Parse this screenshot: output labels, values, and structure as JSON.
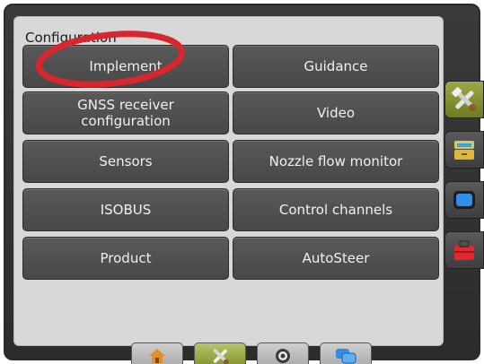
{
  "panel": {
    "title": "Configuration"
  },
  "grid": {
    "implement": "Implement",
    "guidance": "Guidance",
    "gnss": "GNSS receiver configuration",
    "video": "Video",
    "sensors": "Sensors",
    "nozzle": "Nozzle flow monitor",
    "isobus": "ISOBUS",
    "control": "Control channels",
    "product": "Product",
    "autosteer": "AutoSteer"
  },
  "side_tabs": [
    "tools-icon",
    "cabinet-icon",
    "display-icon",
    "toolbox-icon"
  ],
  "bottom_tabs": [
    "home-icon",
    "tools-icon",
    "target-icon",
    "screens-icon"
  ],
  "colors": {
    "annotation": "#d7262e",
    "active_tab": "#8a9a2f",
    "button": "#505050"
  }
}
